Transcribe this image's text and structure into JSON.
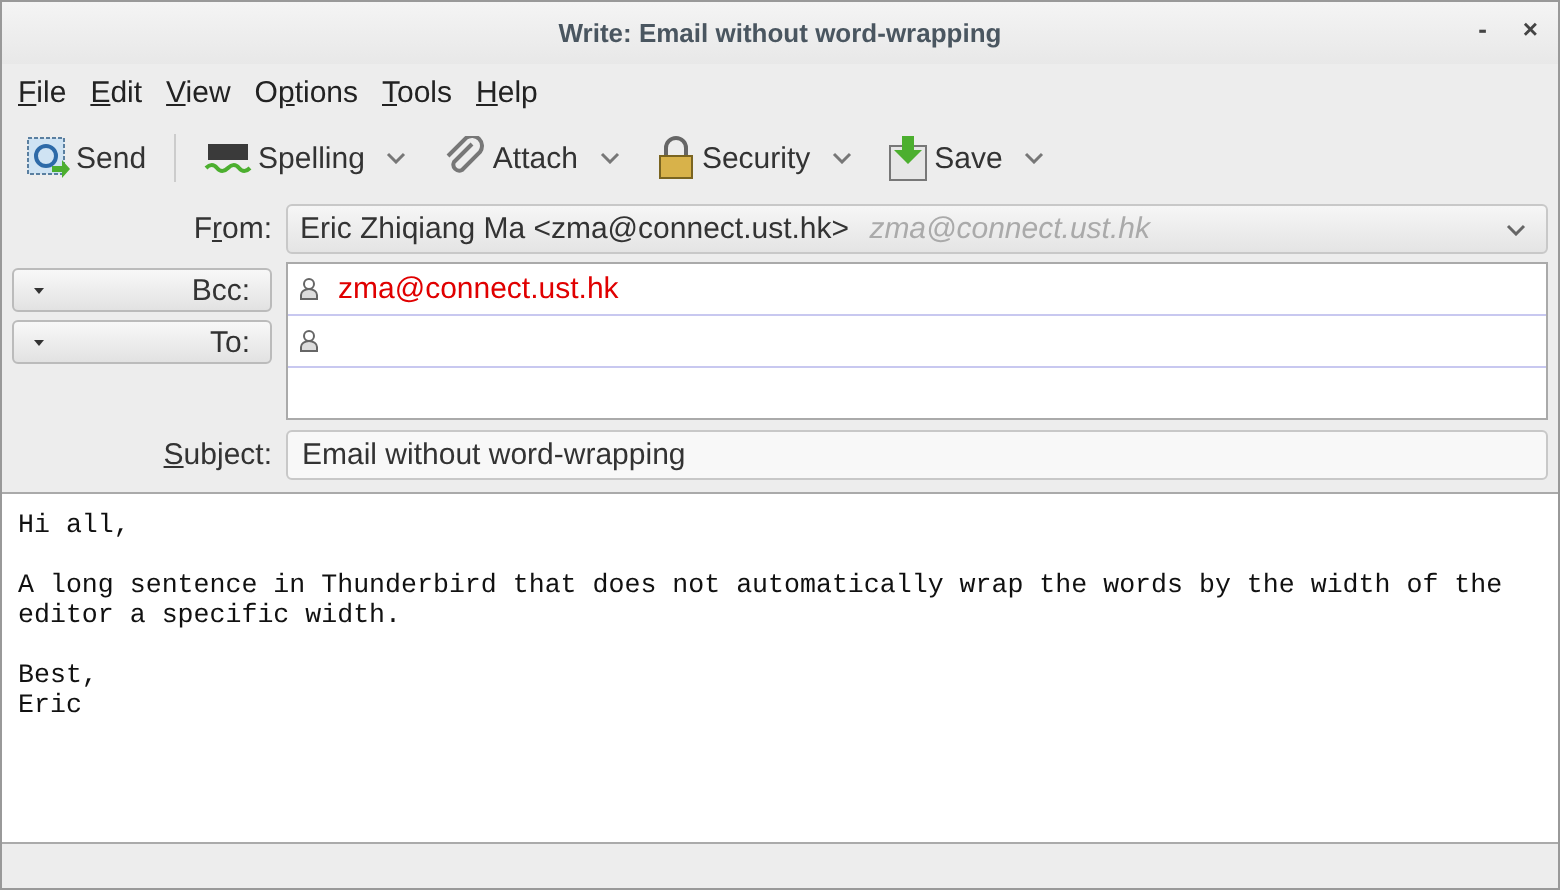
{
  "window": {
    "title": "Write: Email without word-wrapping",
    "controls": [
      "-",
      "×"
    ]
  },
  "menu": [
    {
      "key": "F",
      "post": "ile"
    },
    {
      "key": "E",
      "post": "dit"
    },
    {
      "key": "V",
      "post": "iew"
    },
    {
      "pre": "O",
      "key": "p",
      "post": "tions"
    },
    {
      "key": "T",
      "post": "ools"
    },
    {
      "key": "H",
      "post": "elp"
    }
  ],
  "toolbar": [
    {
      "kind": "send",
      "label": "Send",
      "dropdown": false
    },
    {
      "kind": "spelling",
      "label": "Spelling",
      "dropdown": true
    },
    {
      "kind": "attach",
      "label": "Attach",
      "dropdown": true
    },
    {
      "kind": "security",
      "label": "Security",
      "dropdown": true
    },
    {
      "kind": "save",
      "label": "Save",
      "dropdown": true
    }
  ],
  "from": {
    "label": {
      "pre": "F",
      "key": "r",
      "post": "om:"
    },
    "name": "Eric Zhiqiang Ma <zma@connect.ust.hk>",
    "identity": "zma@connect.ust.hk"
  },
  "recipients": [
    {
      "type": "Bcc:",
      "address": "zma@connect.ust.hk"
    },
    {
      "type": "To:"
    }
  ],
  "subject": {
    "label": {
      "key": "S",
      "post": "ubject:"
    },
    "value": "Email without word-wrapping"
  },
  "body": [
    [
      "Hi all,"
    ],
    [
      "A long sentence in Thunderbird that does not automatically wrap the words by the width of the",
      "editor a specific width."
    ],
    [
      "Best,",
      "Eric"
    ]
  ]
}
